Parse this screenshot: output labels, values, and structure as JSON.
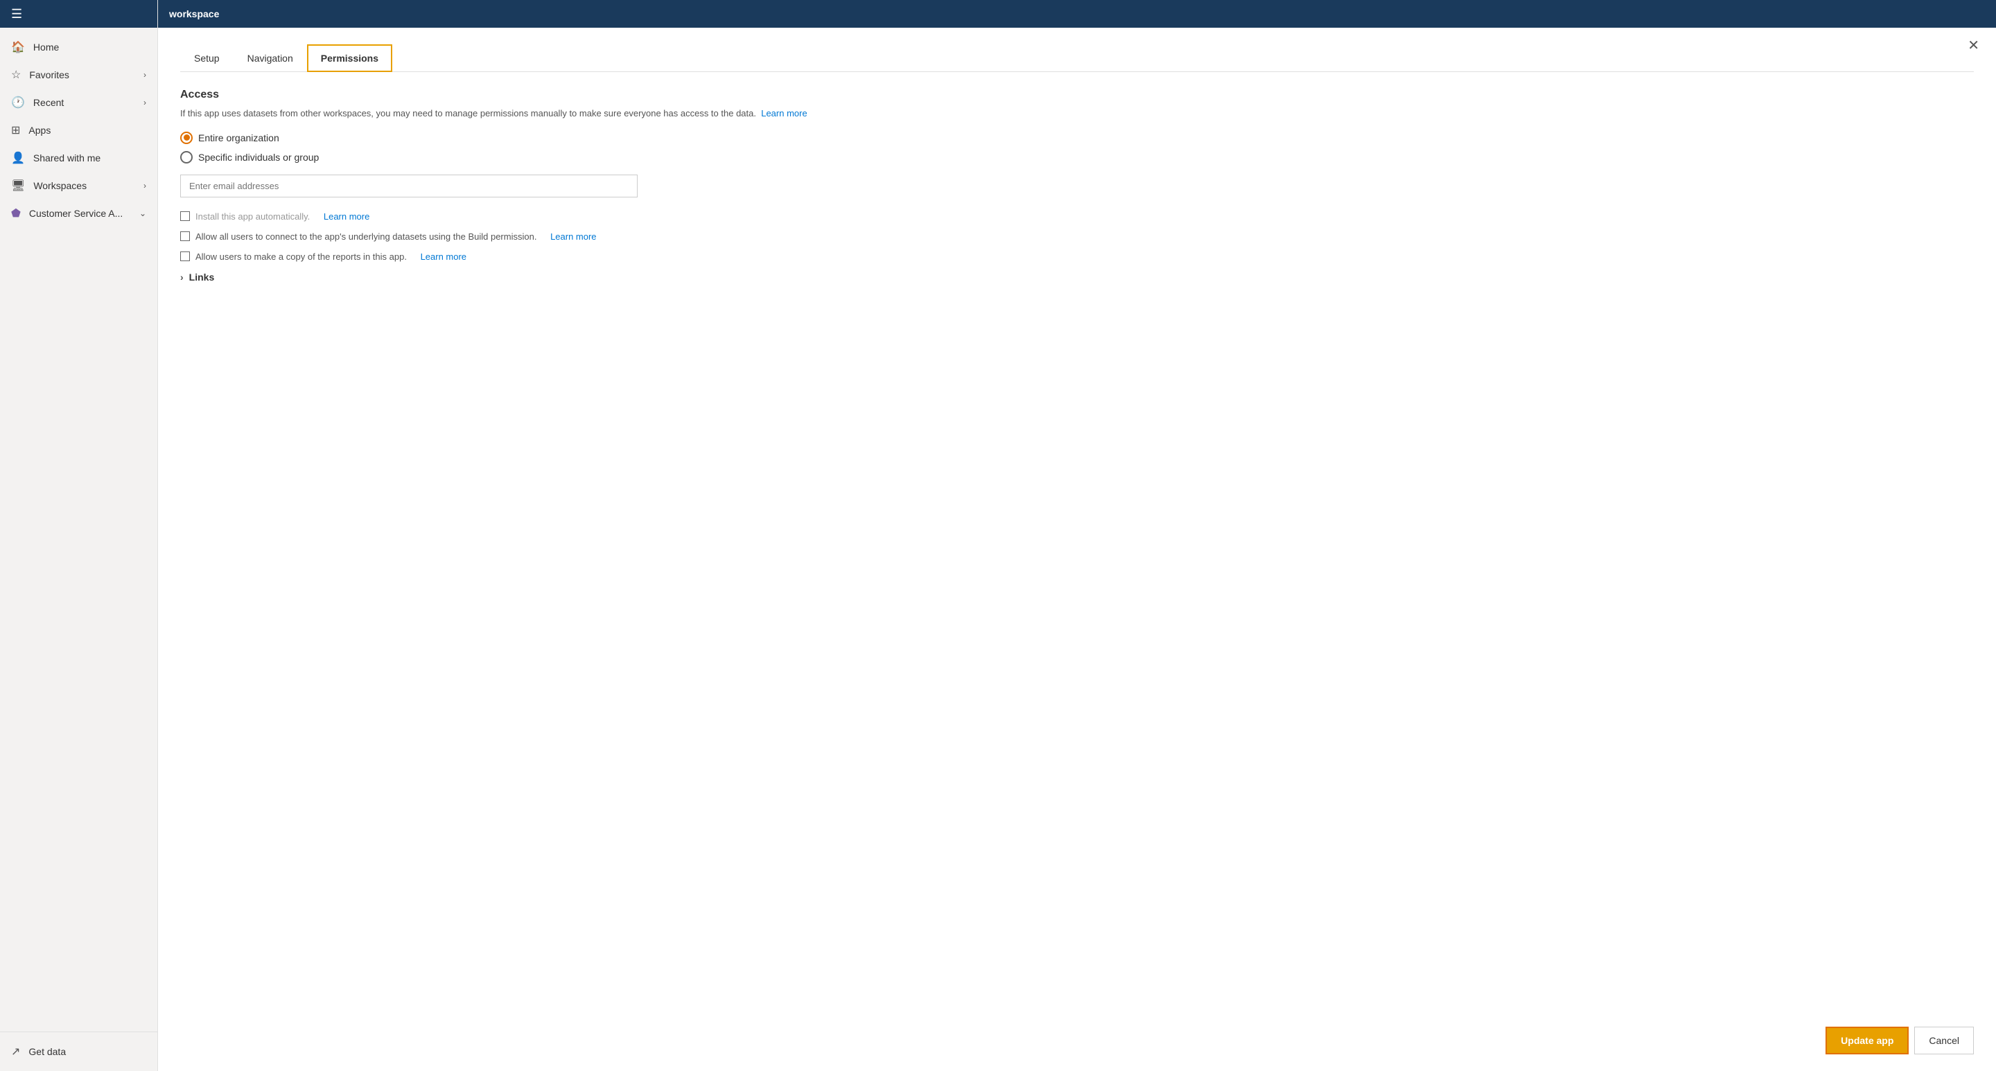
{
  "topbar": {
    "title": "workspace"
  },
  "sidebar": {
    "hamburger": "☰",
    "items": [
      {
        "id": "home",
        "icon": "🏠",
        "label": "Home",
        "hasChevron": false
      },
      {
        "id": "favorites",
        "icon": "☆",
        "label": "Favorites",
        "hasChevron": true
      },
      {
        "id": "recent",
        "icon": "🕐",
        "label": "Recent",
        "hasChevron": true
      },
      {
        "id": "apps",
        "icon": "⊞",
        "label": "Apps",
        "hasChevron": false
      },
      {
        "id": "shared",
        "icon": "👤",
        "label": "Shared with me",
        "hasChevron": false
      },
      {
        "id": "workspaces",
        "icon": "🖥",
        "label": "Workspaces",
        "hasChevron": true
      },
      {
        "id": "customer",
        "icon": "💜",
        "label": "Customer Service A...",
        "hasChevron": true,
        "isPurple": true
      }
    ],
    "bottom": [
      {
        "id": "get-data",
        "icon": "↗",
        "label": "Get data",
        "hasChevron": false
      }
    ]
  },
  "tabs": [
    {
      "id": "setup",
      "label": "Setup",
      "active": false
    },
    {
      "id": "navigation",
      "label": "Navigation",
      "active": false
    },
    {
      "id": "permissions",
      "label": "Permissions",
      "active": true
    }
  ],
  "permissions": {
    "access_title": "Access",
    "access_description": "If this app uses datasets from other workspaces, you may need to manage permissions manually to make sure everyone has access to the data.",
    "access_learn_more": "Learn more",
    "radio_options": [
      {
        "id": "entire-org",
        "label": "Entire organization",
        "selected": true
      },
      {
        "id": "specific",
        "label": "Specific individuals or group",
        "selected": false
      }
    ],
    "email_placeholder": "Enter email addresses",
    "checkboxes": [
      {
        "id": "install-auto",
        "label": "Install this app automatically.",
        "learn_more": "Learn more",
        "checked": false,
        "grayed": true
      },
      {
        "id": "allow-build",
        "label": "Allow all users to connect to the app's underlying datasets using the Build permission.",
        "learn_more": "Learn more",
        "checked": false,
        "grayed": false
      },
      {
        "id": "allow-copy",
        "label": "Allow users to make a copy of the reports in this app.",
        "learn_more": "Learn more",
        "checked": false,
        "grayed": false
      }
    ],
    "links_label": "Links"
  },
  "buttons": {
    "update": "Update app",
    "cancel": "Cancel"
  },
  "icons": {
    "close": "✕",
    "chevron_right": "›",
    "chevron_down": "⌄"
  }
}
